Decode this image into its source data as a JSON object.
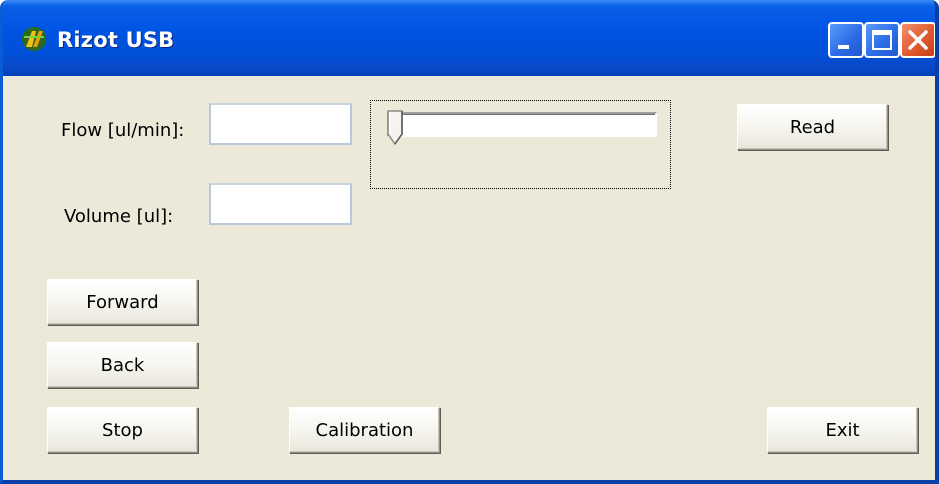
{
  "window": {
    "title": "Rizot USB",
    "app_icon": "rizot-app-icon",
    "controls": [
      "minimize",
      "maximize",
      "close"
    ]
  },
  "form": {
    "flow_label": "Flow [ul/min]:",
    "flow_value": "",
    "volume_label": "Volume [ul]:",
    "volume_value": "",
    "slider_value": 0
  },
  "buttons": {
    "read": "Read",
    "forward": "Forward",
    "back": "Back",
    "stop": "Stop",
    "calibration": "Calibration",
    "exit": "Exit"
  },
  "colors": {
    "titlebar": "#0054e3",
    "dialog_bg": "#ece9d8",
    "close_button": "#e05a30"
  }
}
